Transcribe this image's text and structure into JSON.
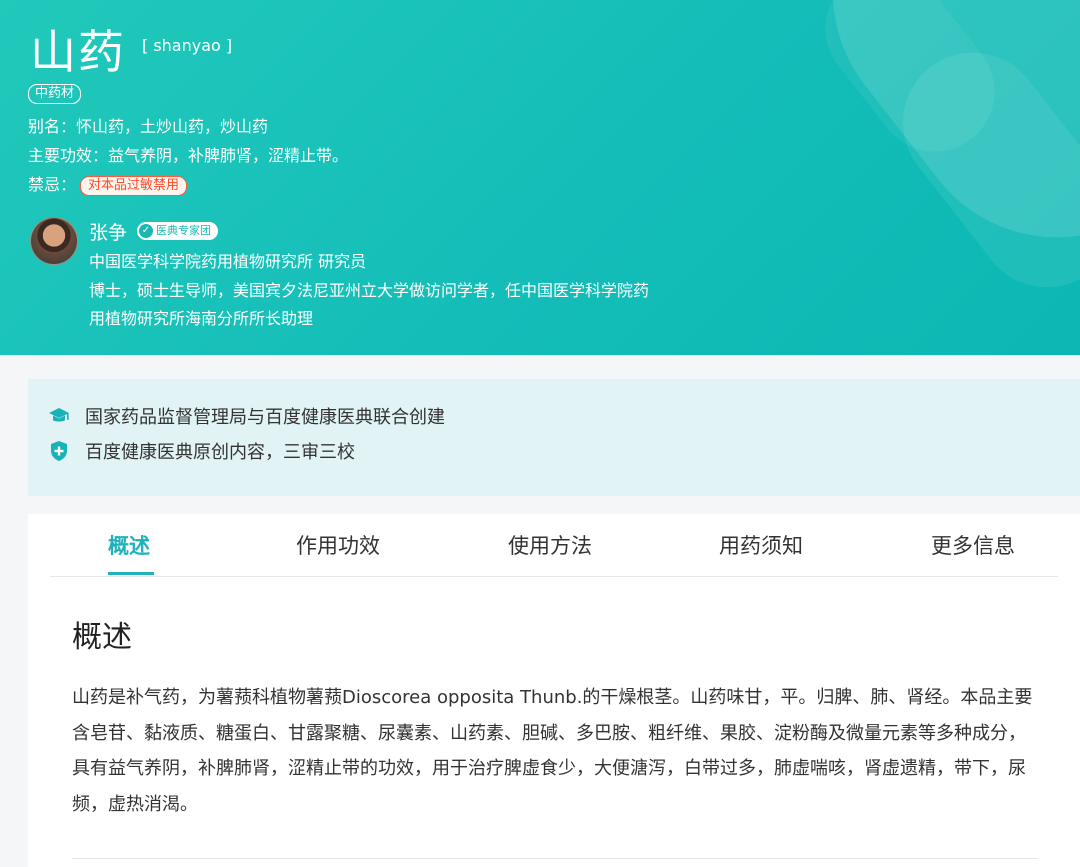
{
  "herb": {
    "name": "山药",
    "pinyin": "[ shanyao ]",
    "category_tag": "中药材",
    "alias_label": "别名：",
    "alias_value": "怀山药，土炒山药，炒山药",
    "effect_label": "主要功效：",
    "effect_value": "益气养阴，补脾肺肾，涩精止带。",
    "forbid_label": "禁忌：",
    "forbid_value": "对本品过敏禁用"
  },
  "expert": {
    "name": "张争",
    "badge": "医典专家团",
    "title": "中国医学科学院药用植物研究所 研究员",
    "bio_line1": "博士，硕士生导师，美国宾夕法尼亚州立大学做访问学者，任中国医学科学院药",
    "bio_line2": "用植物研究所海南分所所长助理"
  },
  "notices": [
    {
      "icon": "graduation-cap-icon",
      "text": "国家药品监督管理局与百度健康医典联合创建"
    },
    {
      "icon": "shield-plus-icon",
      "text": "百度健康医典原创内容，三审三校"
    }
  ],
  "tabs": [
    {
      "label": "概述",
      "active": true
    },
    {
      "label": "作用功效",
      "active": false
    },
    {
      "label": "使用方法",
      "active": false
    },
    {
      "label": "用药须知",
      "active": false
    },
    {
      "label": "更多信息",
      "active": false
    }
  ],
  "section": {
    "title": "概述",
    "body": "山药是补气药，为薯蓣科植物薯蓣Dioscorea opposita Thunb.的干燥根茎。山药味甘，平。归脾、肺、肾经。本品主要含皂苷、黏液质、糖蛋白、甘露聚糖、尿囊素、山药素、胆碱、多巴胺、粗纤维、果胶、淀粉酶及微量元素等多种成分，具有益气养阴，补脾肺肾，涩精止带的功效，用于治疗脾虚食少，大便溏泻，白带过多，肺虚喘咳，肾虚遗精，带下，尿频，虚热消渴。"
  },
  "colors": {
    "brand": "#14bdb8",
    "accent": "#1fb2bd",
    "warning": "#ff4a28",
    "notice_bg": "#e1f3f4"
  }
}
